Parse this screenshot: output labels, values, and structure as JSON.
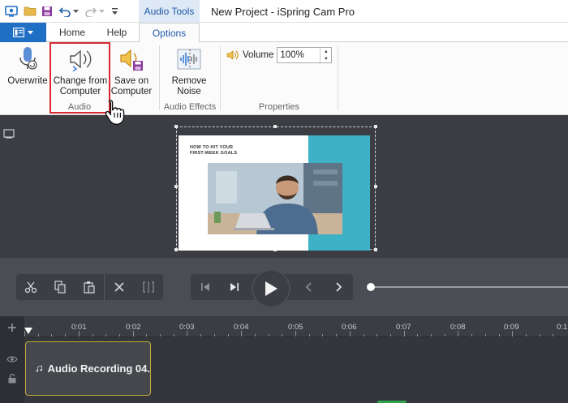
{
  "titlebar": {
    "context_tab": "Audio Tools",
    "window_title": "New Project - iSpring Cam Pro"
  },
  "tabs": [
    {
      "label": "Home"
    },
    {
      "label": "Help"
    },
    {
      "label": "Options"
    }
  ],
  "ribbon": {
    "buttons": [
      {
        "label_line1": "Overwrite",
        "label_line2": "",
        "icon": "microphone-icon"
      },
      {
        "label_line1": "Change from",
        "label_line2": "Computer",
        "icon": "speaker-change-icon"
      },
      {
        "label_line1": "Save on",
        "label_line2": "Computer",
        "icon": "speaker-save-icon"
      },
      {
        "label_line1": "Remove",
        "label_line2": "Noise",
        "icon": "noise-waveform-icon"
      }
    ],
    "groups": {
      "audio": "Audio",
      "audio_effects": "Audio Effects",
      "properties": "Properties"
    },
    "volume": {
      "label": "Volume",
      "value": "100%"
    }
  },
  "slide": {
    "title_line1": "HOW TO HIT YOUR",
    "title_line2": "FIRST-WEEK GOALS"
  },
  "timeline": {
    "ticks": [
      "0:01",
      "0:02",
      "0:03",
      "0:04",
      "0:05",
      "0:06",
      "0:07",
      "0:08",
      "0:09",
      "0:1"
    ],
    "clip_label": "Audio Recording 04."
  },
  "colors": {
    "file_button": "#1f6fc5",
    "highlight": "#d9282f",
    "slide_accent": "#3db1c6",
    "clip_border": "#c9a93c"
  }
}
